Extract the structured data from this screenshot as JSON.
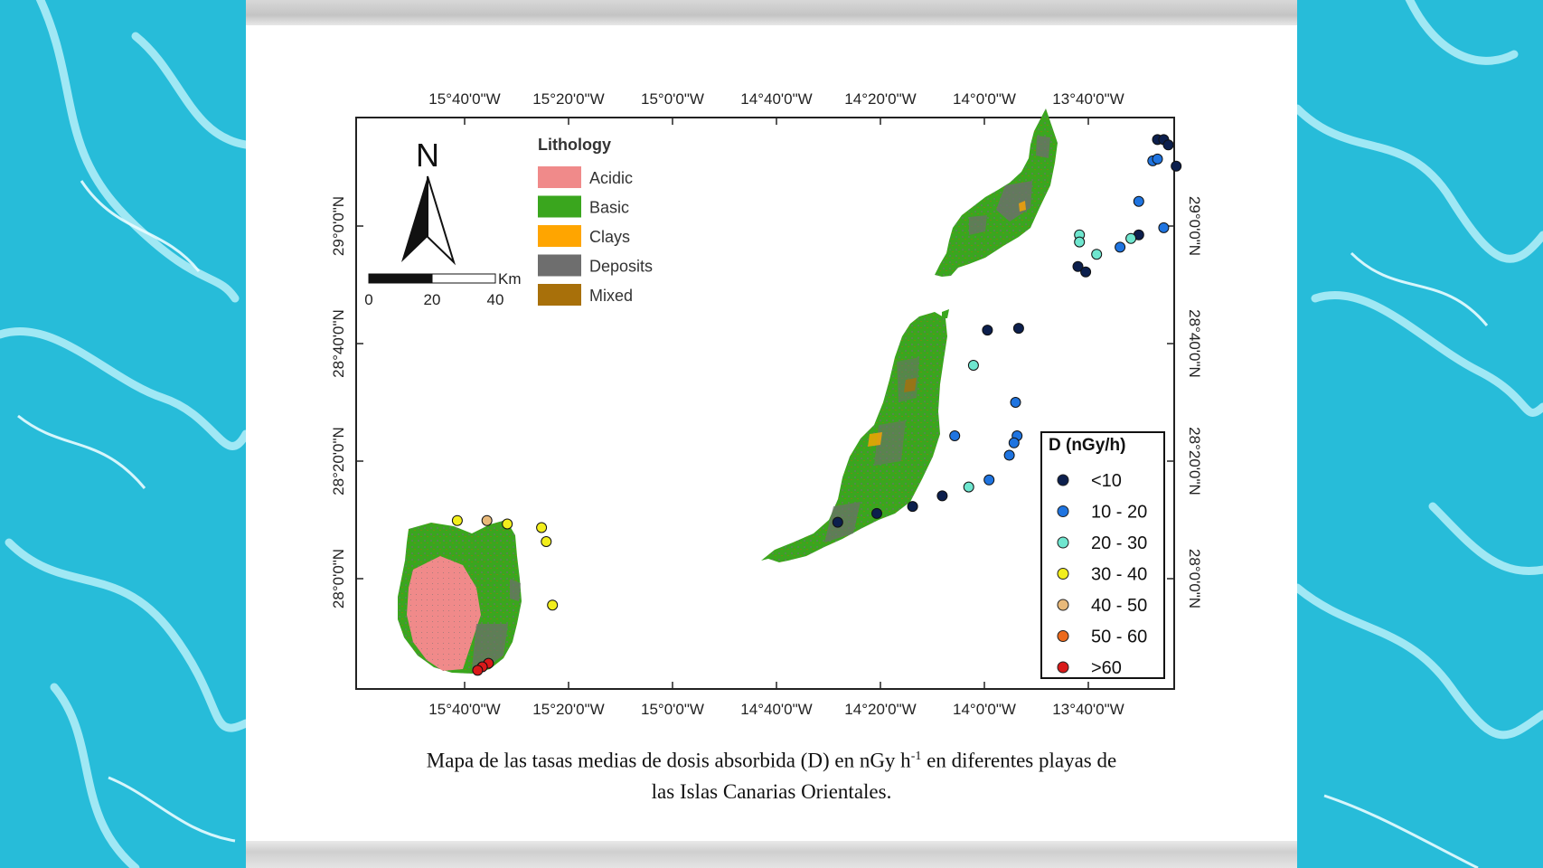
{
  "map": {
    "lon_ticks": [
      "15°40'0\"W",
      "15°20'0\"W",
      "15°0'0\"W",
      "14°40'0\"W",
      "14°20'0\"W",
      "14°0'0\"W",
      "13°40'0\"W"
    ],
    "lat_ticks": [
      "29°0'0\"N",
      "28°40'0\"N",
      "28°20'0\"N",
      "28°0'0\"N"
    ],
    "north_label": "N",
    "scale": {
      "unit": "Km",
      "labels": [
        "0",
        "20",
        "40"
      ]
    },
    "lithology": {
      "title": "Lithology",
      "items": [
        {
          "label": "Acidic",
          "color": "#f08a8a"
        },
        {
          "label": "Basic",
          "color": "#3aa61e"
        },
        {
          "label": "Clays",
          "color": "#ffa500"
        },
        {
          "label": "Deposits",
          "color": "#6e6e6e"
        },
        {
          "label": "Mixed",
          "color": "#a8700a"
        }
      ]
    },
    "dose_legend": {
      "title": "D (nGy/h)",
      "items": [
        {
          "label": "<10",
          "color": "#0c1f4d"
        },
        {
          "label": "10 - 20",
          "color": "#1f74e0"
        },
        {
          "label": "20 - 30",
          "color": "#6fe6cf"
        },
        {
          "label": "30 - 40",
          "color": "#f2ee1c"
        },
        {
          "label": "40 - 50",
          "color": "#e8b97a"
        },
        {
          "label": "50 - 60",
          "color": "#ec6a1c"
        },
        {
          "label": ">60",
          "color": "#d91a1a"
        }
      ]
    },
    "sample_points": [
      {
        "lon": -13.445,
        "lat": 29.245,
        "c": 0
      },
      {
        "lon": -13.425,
        "lat": 29.245,
        "c": 0
      },
      {
        "lon": -13.41,
        "lat": 29.23,
        "c": 0
      },
      {
        "lon": -13.385,
        "lat": 29.17,
        "c": 0
      },
      {
        "lon": -13.46,
        "lat": 29.185,
        "c": 1
      },
      {
        "lon": -13.445,
        "lat": 29.19,
        "c": 1
      },
      {
        "lon": -13.505,
        "lat": 29.07,
        "c": 1
      },
      {
        "lon": -13.425,
        "lat": 28.995,
        "c": 1
      },
      {
        "lon": -13.505,
        "lat": 28.975,
        "c": 0
      },
      {
        "lon": -13.53,
        "lat": 28.965,
        "c": 2
      },
      {
        "lon": -13.565,
        "lat": 28.94,
        "c": 1
      },
      {
        "lon": -13.64,
        "lat": 28.92,
        "c": 2
      },
      {
        "lon": -13.695,
        "lat": 28.975,
        "c": 2
      },
      {
        "lon": -13.695,
        "lat": 28.955,
        "c": 2
      },
      {
        "lon": -13.7,
        "lat": 28.885,
        "c": 0
      },
      {
        "lon": -13.675,
        "lat": 28.87,
        "c": 0
      },
      {
        "lon": -13.99,
        "lat": 28.705,
        "c": 0
      },
      {
        "lon": -13.89,
        "lat": 28.71,
        "c": 0
      },
      {
        "lon": -14.035,
        "lat": 28.605,
        "c": 2
      },
      {
        "lon": -13.9,
        "lat": 28.5,
        "c": 1
      },
      {
        "lon": -14.095,
        "lat": 28.405,
        "c": 1
      },
      {
        "lon": -13.895,
        "lat": 28.405,
        "c": 1
      },
      {
        "lon": -13.905,
        "lat": 28.385,
        "c": 1
      },
      {
        "lon": -13.92,
        "lat": 28.35,
        "c": 1
      },
      {
        "lon": -13.985,
        "lat": 28.28,
        "c": 1
      },
      {
        "lon": -14.05,
        "lat": 28.26,
        "c": 2
      },
      {
        "lon": -14.135,
        "lat": 28.235,
        "c": 0
      },
      {
        "lon": -14.23,
        "lat": 28.205,
        "c": 0
      },
      {
        "lon": -14.345,
        "lat": 28.185,
        "c": 0
      },
      {
        "lon": -14.47,
        "lat": 28.16,
        "c": 0
      },
      {
        "lon": -15.69,
        "lat": 28.165,
        "c": 3
      },
      {
        "lon": -15.595,
        "lat": 28.165,
        "c": 4
      },
      {
        "lon": -15.53,
        "lat": 28.155,
        "c": 3
      },
      {
        "lon": -15.42,
        "lat": 28.145,
        "c": 3
      },
      {
        "lon": -15.405,
        "lat": 28.105,
        "c": 3
      },
      {
        "lon": -15.385,
        "lat": 27.925,
        "c": 3
      },
      {
        "lon": -15.59,
        "lat": 27.76,
        "c": 6
      },
      {
        "lon": -15.61,
        "lat": 27.75,
        "c": 6
      },
      {
        "lon": -15.625,
        "lat": 27.74,
        "c": 6
      }
    ]
  },
  "caption": {
    "line1_a": "Mapa de las tasas medias de dosis absorbida (D) en nGy h",
    "line1_sup": "-1",
    "line1_b": " en diferentes playas de",
    "line2": "las Islas Canarias Orientales."
  }
}
